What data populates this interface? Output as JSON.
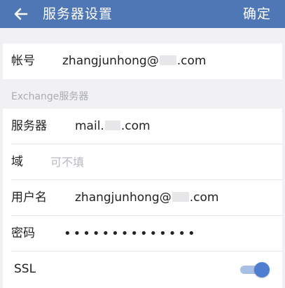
{
  "header": {
    "title": "服务器设置",
    "confirm_label": "确定",
    "color": "#4f76b5"
  },
  "account": {
    "label": "帐号",
    "value_prefix": "zhangjunhong@",
    "value_suffix": ".com"
  },
  "section": {
    "label": "Exchange服务器"
  },
  "server_settings": {
    "server": {
      "label": "服务器",
      "value_prefix": "mail.",
      "value_suffix": ".com"
    },
    "domain": {
      "label": "域",
      "placeholder": "可不填"
    },
    "username": {
      "label": "用户名",
      "value_prefix": "zhangjunhong@",
      "value_suffix": ".com"
    },
    "password": {
      "label": "密码",
      "value": "••••••••••••••"
    },
    "ssl": {
      "label": "SSL",
      "enabled": true,
      "color": "#4f7ed1"
    }
  }
}
